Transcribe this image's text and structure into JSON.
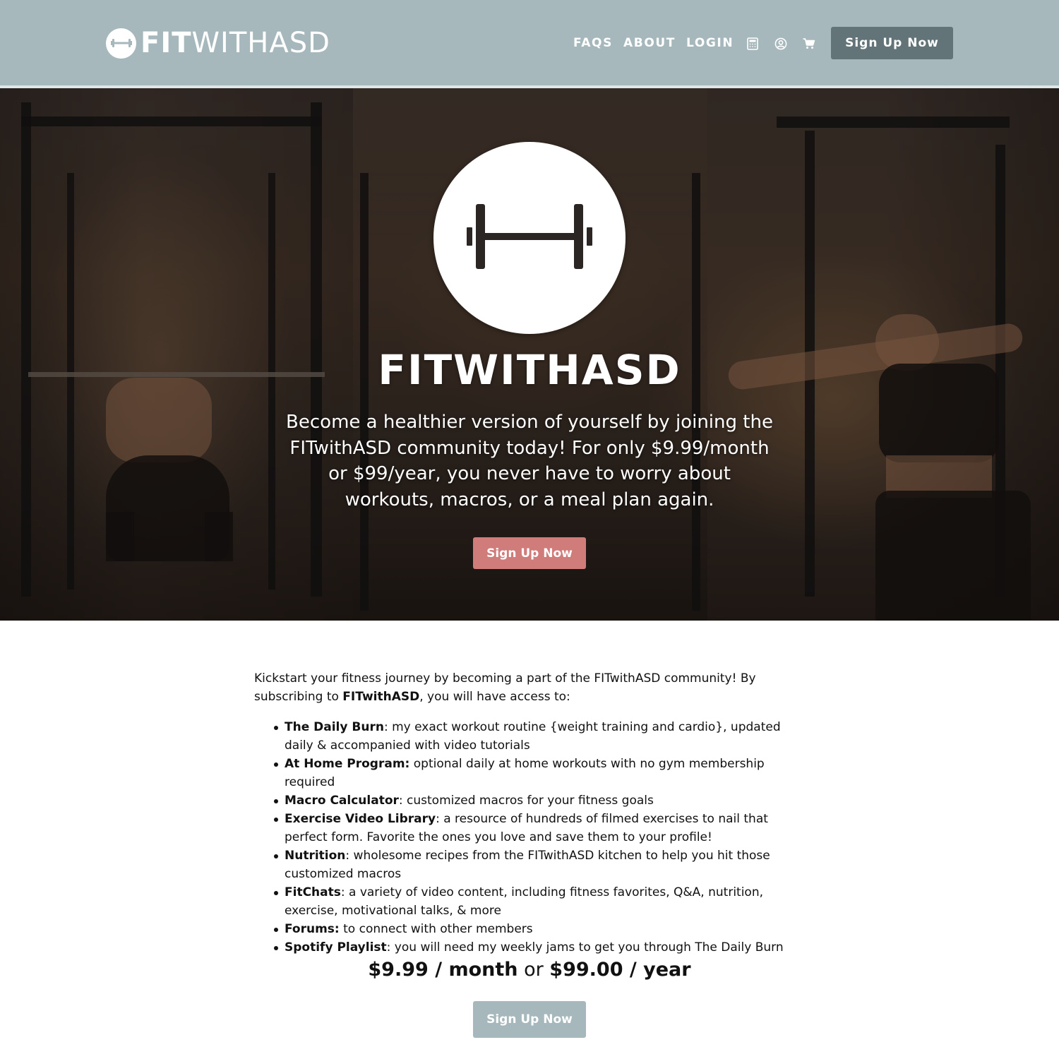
{
  "header": {
    "logo_bold": "FIT",
    "logo_light": "WITHASD",
    "nav": [
      {
        "label": "FAQS"
      },
      {
        "label": "ABOUT"
      },
      {
        "label": "LOGIN"
      }
    ],
    "icons": [
      "calculator-icon",
      "account-icon",
      "cart-icon"
    ],
    "cta_label": "Sign Up Now",
    "background_color": "#a7b8bd",
    "cta_color": "#637478"
  },
  "hero": {
    "icon": "dumbbell-icon",
    "title_bold": "FIT",
    "title_light": "WITHASD",
    "text": "Become a healthier version of yourself by joining the FITwithASD community today! For only $9.99/month or $99/year, you never have to worry about workouts, macros, or a meal plan again.",
    "cta_label": "Sign Up Now",
    "cta_color": "#cf7c7a"
  },
  "content": {
    "intro_part1": "Kickstart your fitness journey by becoming a part of the FITwithASD community! By subscribing to ",
    "intro_bold": "FITwithASD",
    "intro_part2": ", you will have access to:",
    "features": [
      {
        "name": "The Daily Burn",
        "desc": ": my exact workout routine {weight training and cardio}, updated daily & accompanied with video tutorials"
      },
      {
        "name": "At Home Program:",
        "desc": " optional daily at home workouts with no gym membership required"
      },
      {
        "name": "Macro Calculator",
        "desc": ": customized macros for your fitness goals"
      },
      {
        "name": "Exercise Video Library",
        "desc": ": a resource of hundreds of filmed exercises to nail that perfect form.  Favorite the ones you love and save them to your profile!"
      },
      {
        "name": "Nutrition",
        "desc": ": wholesome recipes from the FITwithASD kitchen to help you hit those customized macros"
      },
      {
        "name": "FitChats",
        "desc": ": a variety of video content, including fitness favorites, Q&A, nutrition, exercise, motivational talks, & more"
      },
      {
        "name": "Forums:",
        "desc": " to connect with other members"
      },
      {
        "name": "Spotify Playlist",
        "desc": ": you will need my weekly jams to get you through The Daily Burn"
      }
    ],
    "price_month": "$9.99 / month",
    "price_or": " or ",
    "price_year": "$99.00 / year",
    "cta_label": "Sign Up Now",
    "cta_color": "#a7b8bd"
  }
}
